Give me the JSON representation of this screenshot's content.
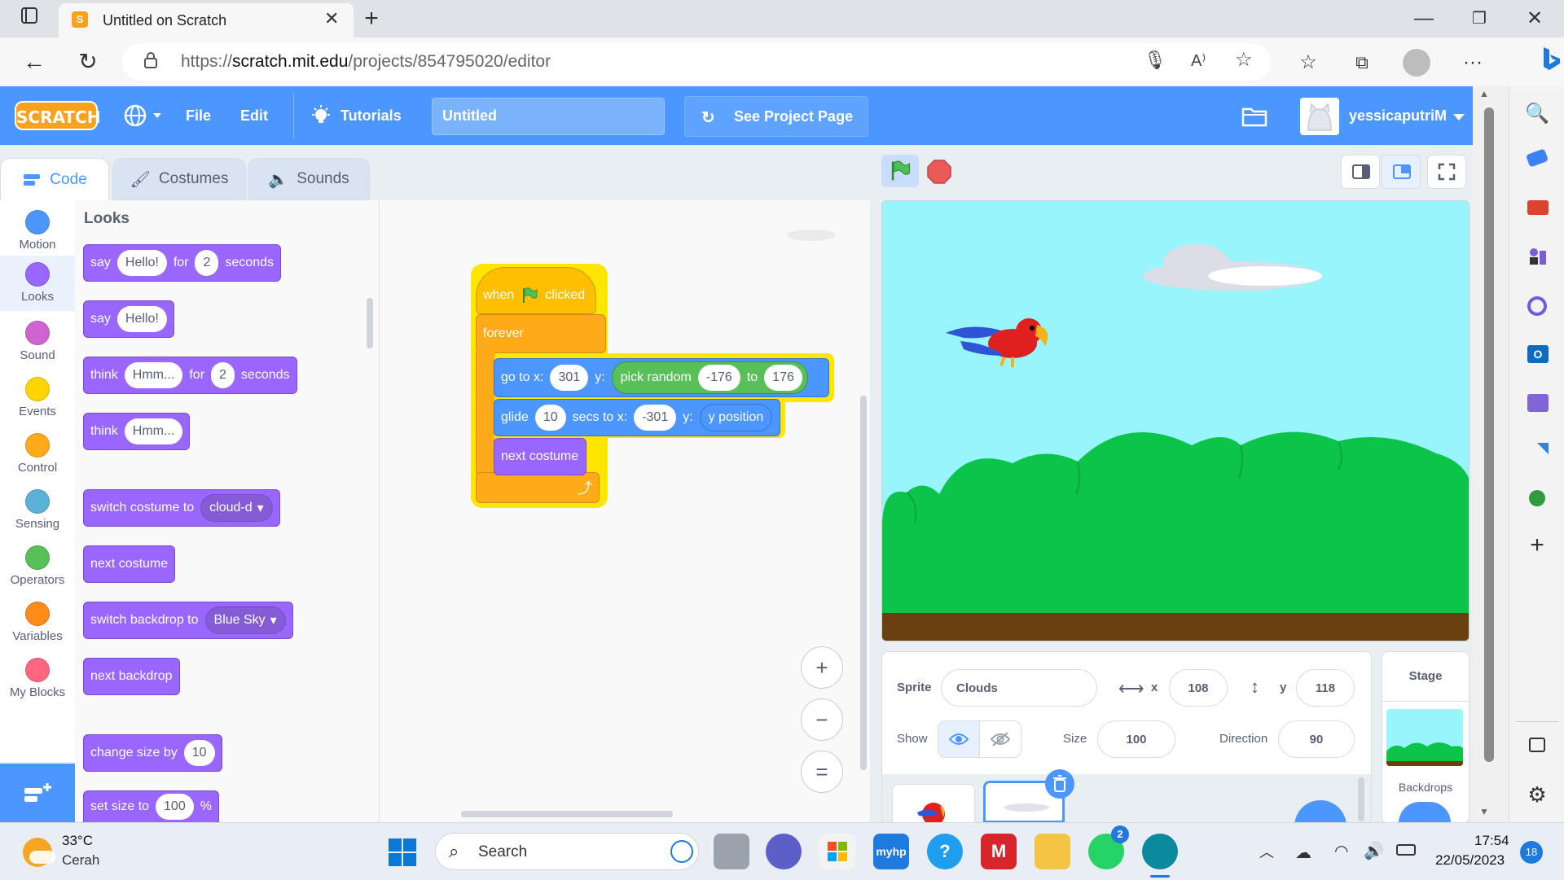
{
  "browser": {
    "tab_title": "Untitled on Scratch",
    "url_prefix": "https://",
    "url_domain": "scratch.mit.edu",
    "url_path": "/projects/854795020/editor"
  },
  "menubar": {
    "logo": "SCRATCH",
    "file": "File",
    "edit": "Edit",
    "tutorials": "Tutorials",
    "project_title": "Untitled",
    "see_project_page": "See Project Page",
    "username": "yessicaputriM"
  },
  "tabs": {
    "code": "Code",
    "costumes": "Costumes",
    "sounds": "Sounds"
  },
  "categories": [
    {
      "label": "Motion",
      "color": "#4c97ff"
    },
    {
      "label": "Looks",
      "color": "#9966ff"
    },
    {
      "label": "Sound",
      "color": "#cf63cf"
    },
    {
      "label": "Events",
      "color": "#ffd500"
    },
    {
      "label": "Control",
      "color": "#ffab19"
    },
    {
      "label": "Sensing",
      "color": "#5cb1d6"
    },
    {
      "label": "Operators",
      "color": "#59c059"
    },
    {
      "label": "Variables",
      "color": "#ff8c1a"
    },
    {
      "label": "My Blocks",
      "color": "#ff6680"
    }
  ],
  "palette": {
    "heading": "Looks",
    "b1": {
      "say": "say",
      "msg": "Hello!",
      "for": "for",
      "secs": "2",
      "seconds": "seconds"
    },
    "b2": {
      "say": "say",
      "msg": "Hello!"
    },
    "b3": {
      "think": "think",
      "msg": "Hmm...",
      "for": "for",
      "secs": "2",
      "seconds": "seconds"
    },
    "b4": {
      "think": "think",
      "msg": "Hmm..."
    },
    "b5": {
      "label": "switch costume to",
      "value": "cloud-d"
    },
    "b6": {
      "label": "next costume"
    },
    "b7": {
      "label": "switch backdrop to",
      "value": "Blue Sky"
    },
    "b8": {
      "label": "next backdrop"
    },
    "b9": {
      "label": "change size by",
      "value": "10"
    },
    "b10": {
      "label": "set size to",
      "value": "100",
      "unit": "%"
    }
  },
  "script": {
    "hat_when": "when",
    "hat_clicked": "clicked",
    "forever": "forever",
    "goto_label": "go to x:",
    "goto_x": "301",
    "goto_y_label": "y:",
    "pick_random": "pick random",
    "random_from": "-176",
    "random_to_label": "to",
    "random_to": "176",
    "glide_label": "glide",
    "glide_secs": "10",
    "glide_secs_label": "secs to x:",
    "glide_x": "-301",
    "glide_y_label": "y:",
    "y_position": "y position",
    "next_costume": "next costume"
  },
  "zoom": {
    "in": "+",
    "out": "−",
    "reset": "="
  },
  "sprite_panel": {
    "sprite_label": "Sprite",
    "sprite_name": "Clouds",
    "x_label": "x",
    "x_value": "108",
    "y_label": "y",
    "y_value": "118",
    "show_label": "Show",
    "size_label": "Size",
    "size_value": "100",
    "direction_label": "Direction",
    "direction_value": "90"
  },
  "stage_panel": {
    "title": "Stage",
    "backdrops": "Backdrops"
  },
  "taskbar": {
    "temperature": "33°C",
    "weather": "Cerah",
    "search": "Search",
    "time": "17:54",
    "date": "22/05/2023",
    "notifications": "18",
    "whatsapp_badge": "2"
  }
}
